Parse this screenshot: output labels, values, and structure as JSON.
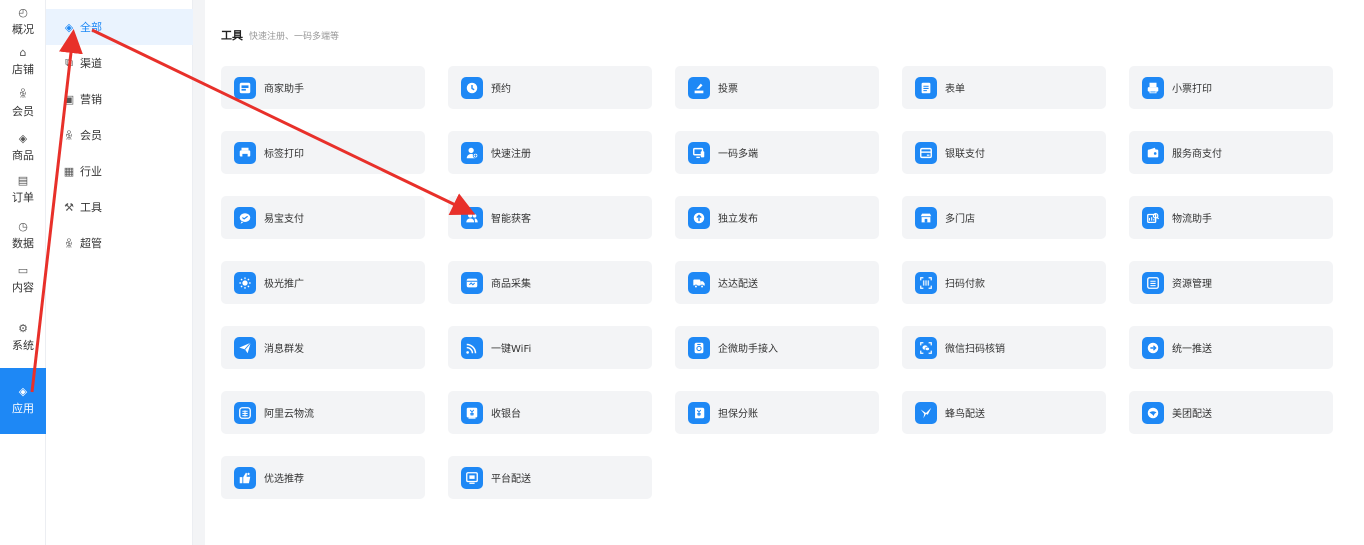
{
  "rail": {
    "items": [
      {
        "label": "概况",
        "icon": "dashboard-icon"
      },
      {
        "label": "店铺",
        "icon": "store-icon"
      },
      {
        "label": "会员",
        "icon": "member-icon"
      },
      {
        "label": "商品",
        "icon": "goods-icon"
      },
      {
        "label": "订单",
        "icon": "order-icon"
      },
      {
        "label": "数据",
        "icon": "data-icon"
      },
      {
        "label": "内容",
        "icon": "content-icon"
      },
      {
        "label": "系统",
        "icon": "system-icon"
      },
      {
        "label": "应用",
        "icon": "app-icon",
        "active": true
      }
    ]
  },
  "submenu": {
    "items": [
      {
        "label": "全部",
        "icon": "cube-icon",
        "active": true
      },
      {
        "label": "渠道",
        "icon": "channel-icon"
      },
      {
        "label": "营销",
        "icon": "marketing-icon"
      },
      {
        "label": "会员",
        "icon": "member-icon"
      },
      {
        "label": "行业",
        "icon": "industry-icon"
      },
      {
        "label": "工具",
        "icon": "tool-icon"
      },
      {
        "label": "超管",
        "icon": "admin-icon"
      }
    ]
  },
  "section": {
    "title": "工具",
    "subtitle": "快速注册、一码多端等"
  },
  "tools": [
    {
      "label": "商家助手",
      "icon": "app-assistant-icon"
    },
    {
      "label": "预约",
      "icon": "clock-icon"
    },
    {
      "label": "投票",
      "icon": "vote-icon"
    },
    {
      "label": "表单",
      "icon": "form-icon"
    },
    {
      "label": "小票打印",
      "icon": "receipt-printer-icon"
    },
    {
      "label": "标签打印",
      "icon": "label-printer-icon"
    },
    {
      "label": "快速注册",
      "icon": "user-add-icon"
    },
    {
      "label": "一码多端",
      "icon": "multi-device-icon"
    },
    {
      "label": "银联支付",
      "icon": "card-icon"
    },
    {
      "label": "服务商支付",
      "icon": "wallet-icon"
    },
    {
      "label": "易宝支付",
      "icon": "chat-bubble-icon"
    },
    {
      "label": "智能获客",
      "icon": "users-icon"
    },
    {
      "label": "独立发布",
      "icon": "upload-icon"
    },
    {
      "label": "多门店",
      "icon": "multi-store-icon"
    },
    {
      "label": "物流助手",
      "icon": "logistics-search-icon"
    },
    {
      "label": "极光推广",
      "icon": "sun-icon"
    },
    {
      "label": "商品采集",
      "icon": "goods-collect-icon"
    },
    {
      "label": "达达配送",
      "icon": "truck-icon"
    },
    {
      "label": "扫码付款",
      "icon": "scan-barcode-icon"
    },
    {
      "label": "资源管理",
      "icon": "resource-icon"
    },
    {
      "label": "消息群发",
      "icon": "send-icon"
    },
    {
      "label": "一键WiFi",
      "icon": "wifi-icon"
    },
    {
      "label": "企微助手接入",
      "icon": "wecom-icon"
    },
    {
      "label": "微信扫码核销",
      "icon": "wechat-scan-icon"
    },
    {
      "label": "统一推送",
      "icon": "push-icon"
    },
    {
      "label": "阿里云物流",
      "icon": "cloud-logistics-icon"
    },
    {
      "label": "收银台",
      "icon": "cashier-icon"
    },
    {
      "label": "担保分账",
      "icon": "guarantee-icon"
    },
    {
      "label": "蜂鸟配送",
      "icon": "hummingbird-icon"
    },
    {
      "label": "美团配送",
      "icon": "meituan-icon"
    },
    {
      "label": "优选推荐",
      "icon": "thumbs-up-icon"
    },
    {
      "label": "平台配送",
      "icon": "platform-delivery-icon"
    }
  ],
  "colors": {
    "accent": "#1e88f5",
    "annotation_arrow": "#e8302a"
  }
}
